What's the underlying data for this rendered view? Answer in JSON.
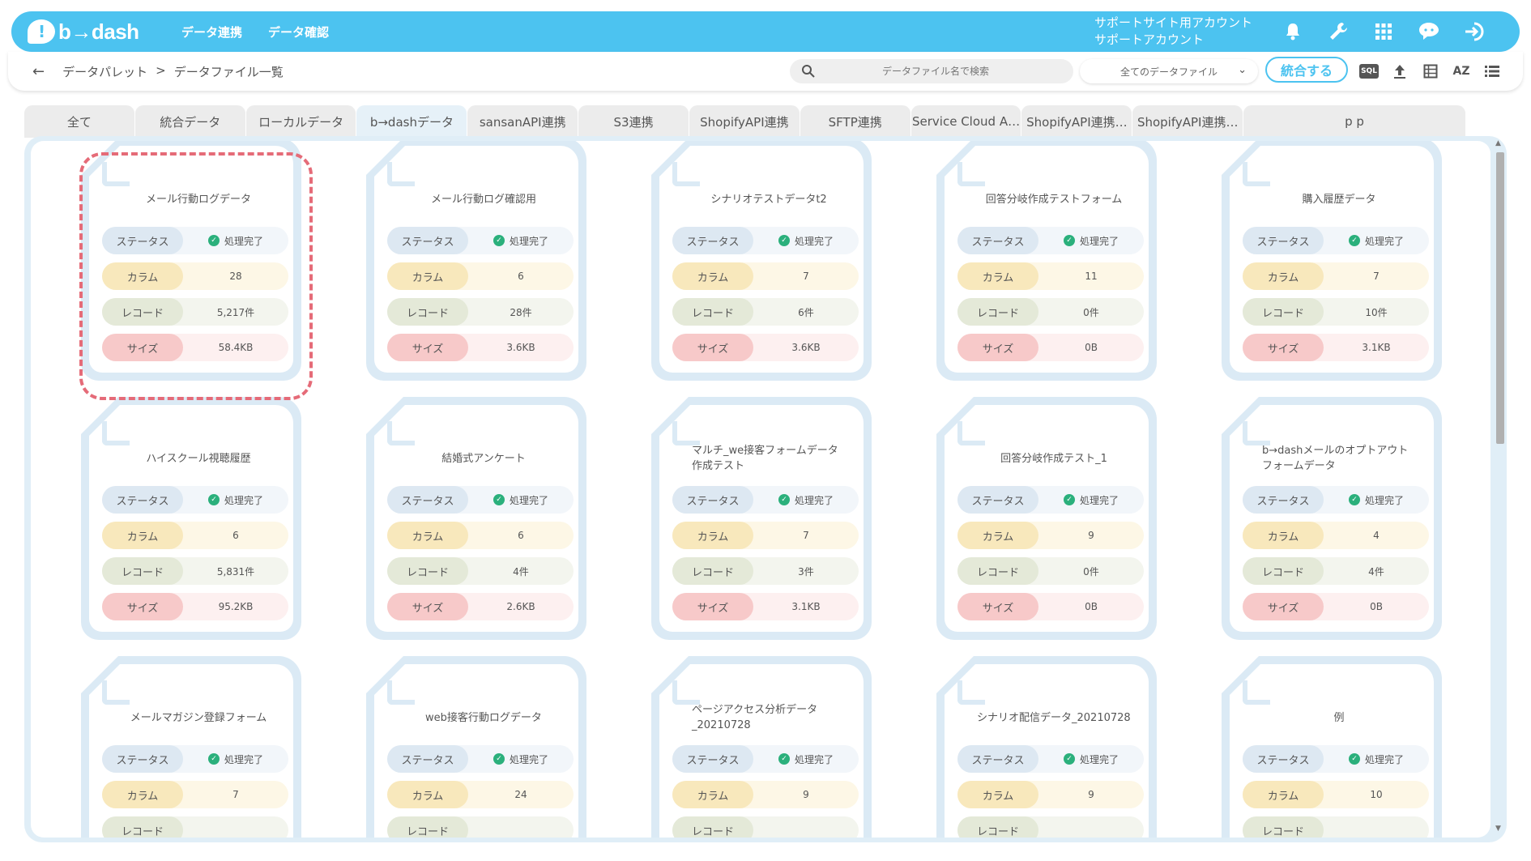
{
  "header": {
    "logo_text": "b→dash",
    "nav": [
      "データ連携",
      "データ確認"
    ],
    "account_line1": "サポートサイト用アカウント",
    "account_line2": "サポートアカウント"
  },
  "toolbar": {
    "breadcrumb": [
      "データパレット",
      ">",
      "データファイル一覧"
    ],
    "search_placeholder": "データファイル名で検索",
    "filter_selected": "全てのデータファイル",
    "merge_button": "統合する",
    "sql_label": "SQL",
    "sort_label": "AZ"
  },
  "tabs": [
    "全て",
    "統合データ",
    "ローカルデータ",
    "b→dashデータ",
    "sansanAPI連携",
    "S3連携",
    "ShopifyAPI連携",
    "SFTP連携",
    "Service Cloud A…",
    "ShopifyAPI連携…",
    "ShopifyAPI連携…",
    "p p"
  ],
  "active_tab": 3,
  "labels": {
    "status": "ステータス",
    "column": "カラム",
    "record": "レコード",
    "size": "サイズ"
  },
  "cards": [
    {
      "title": "メール行動ログデータ",
      "status": "処理完了",
      "columns": "28",
      "records": "5,217件",
      "size": "58.4KB"
    },
    {
      "title": "メール行動ログ確認用",
      "status": "処理完了",
      "columns": "6",
      "records": "28件",
      "size": "3.6KB"
    },
    {
      "title": "シナリオテストデータt2",
      "status": "処理完了",
      "columns": "7",
      "records": "6件",
      "size": "3.6KB"
    },
    {
      "title": "回答分岐作成テストフォーム",
      "status": "処理完了",
      "columns": "11",
      "records": "0件",
      "size": "0B"
    },
    {
      "title": "購入履歴データ",
      "status": "処理完了",
      "columns": "7",
      "records": "10件",
      "size": "3.1KB"
    },
    {
      "title": "ハイスクール視聴履歴",
      "status": "処理完了",
      "columns": "6",
      "records": "5,831件",
      "size": "95.2KB"
    },
    {
      "title": "結婚式アンケート",
      "status": "処理完了",
      "columns": "6",
      "records": "4件",
      "size": "2.6KB"
    },
    {
      "title": "マルチ_we接客フォームデータ作成テスト",
      "status": "処理完了",
      "columns": "7",
      "records": "3件",
      "size": "3.1KB"
    },
    {
      "title": "回答分岐作成テスト_1",
      "status": "処理完了",
      "columns": "9",
      "records": "0件",
      "size": "0B"
    },
    {
      "title": "b→dashメールのオプトアウトフォームデータ",
      "status": "処理完了",
      "columns": "4",
      "records": "4件",
      "size": "0B"
    },
    {
      "title": "メールマガジン登録フォーム",
      "status": "処理完了",
      "columns": "7",
      "records": "",
      "size": ""
    },
    {
      "title": "web接客行動ログデータ",
      "status": "処理完了",
      "columns": "24",
      "records": "",
      "size": ""
    },
    {
      "title": "ページアクセス分析データ_20210728",
      "status": "処理完了",
      "columns": "9",
      "records": "",
      "size": ""
    },
    {
      "title": "シナリオ配信データ_20210728",
      "status": "処理完了",
      "columns": "9",
      "records": "",
      "size": ""
    },
    {
      "title": "例",
      "status": "処理完了",
      "columns": "10",
      "records": "",
      "size": ""
    }
  ]
}
